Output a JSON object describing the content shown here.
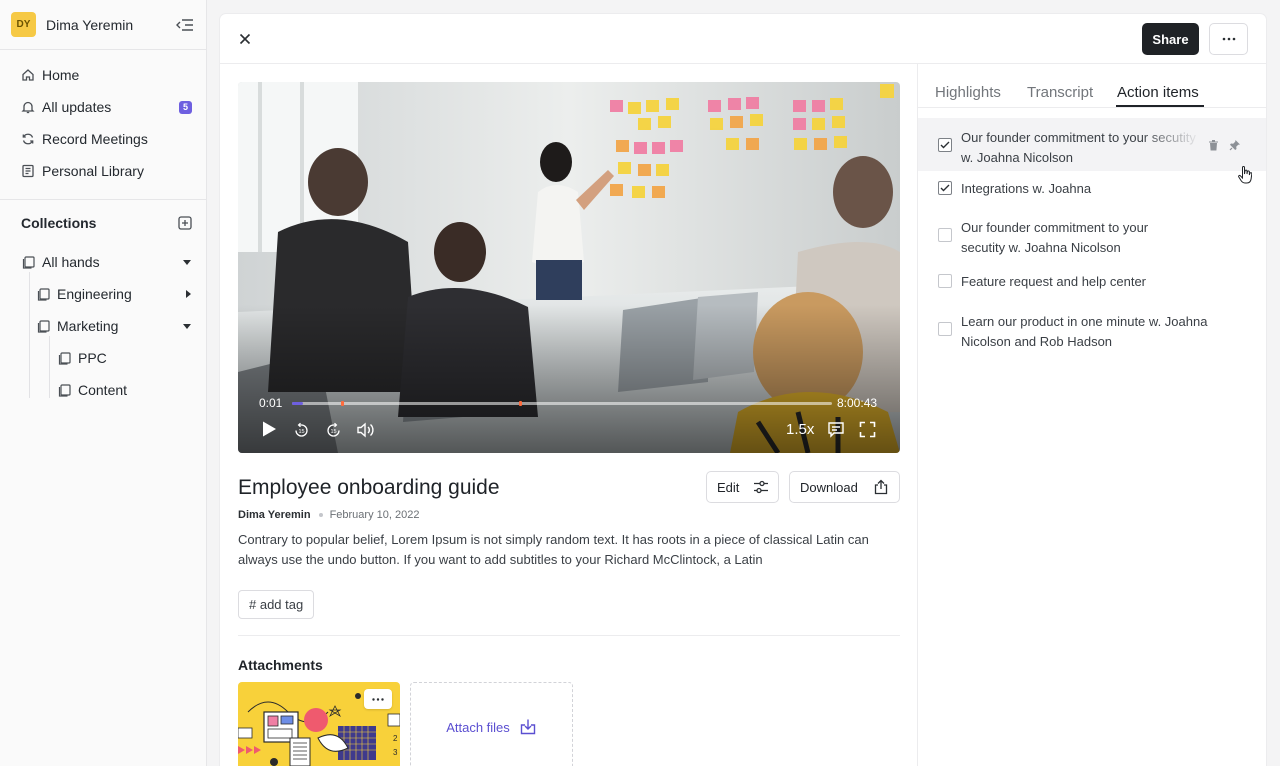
{
  "user": {
    "initials": "DY",
    "name": "Dima Yeremin"
  },
  "nav": [
    {
      "label": "Home",
      "icon": "home-icon"
    },
    {
      "label": "All updates",
      "icon": "bell-icon",
      "badge": "5"
    },
    {
      "label": "Record Meetings",
      "icon": "refresh-icon"
    },
    {
      "label": "Personal Library",
      "icon": "library-icon"
    }
  ],
  "collections": {
    "title": "Collections",
    "items": [
      {
        "label": "All hands",
        "level": 0,
        "caret": "down"
      },
      {
        "label": "Engineering",
        "level": 1,
        "caret": "right"
      },
      {
        "label": "Marketing",
        "level": 1,
        "caret": "down"
      },
      {
        "label": "PPC",
        "level": 2
      },
      {
        "label": "Content",
        "level": 2
      }
    ]
  },
  "toolbar": {
    "share_label": "Share"
  },
  "video": {
    "current_time": "0:01",
    "duration": "8:00:43",
    "progress": 0.02,
    "markers": [
      0.09,
      0.42
    ],
    "speed": "1.5x"
  },
  "recording": {
    "title": "Employee onboarding guide",
    "author": "Dima Yeremin",
    "date": "February 10, 2022",
    "description": "Contrary to popular belief, Lorem Ipsum is not simply random text. It has roots in a piece of classical Latin can always use the undo button. If you want to add subtitles to your Richard McClintock, a Latin",
    "tag_placeholder": "# add tag",
    "edit_label": "Edit",
    "download_label": "Download"
  },
  "attachments": {
    "title": "Attachments",
    "attach_label": "Attach files"
  },
  "tabs": [
    {
      "label": "Highlights",
      "active": false
    },
    {
      "label": "Transcript",
      "active": false
    },
    {
      "label": "Action items",
      "active": true
    }
  ],
  "action_items": [
    {
      "text": "Our founder commitment to your secutity w. Joahna Nicolson",
      "checked": true,
      "hovered": true
    },
    {
      "text": "Integrations w. Joahna",
      "checked": true
    },
    {
      "text": "Our founder commitment to your secutity w. Joahna Nicolson",
      "checked": false
    },
    {
      "text": "Feature request and help center",
      "checked": false
    },
    {
      "text": "Learn our product in one minute w. Joahna Nicolson and Rob Hadson",
      "checked": false
    }
  ],
  "colors": {
    "accent": "#6e5fe0",
    "share_bg": "#1f2226",
    "avatar_bg": "#f6c945",
    "marker": "#ff6b3d"
  }
}
